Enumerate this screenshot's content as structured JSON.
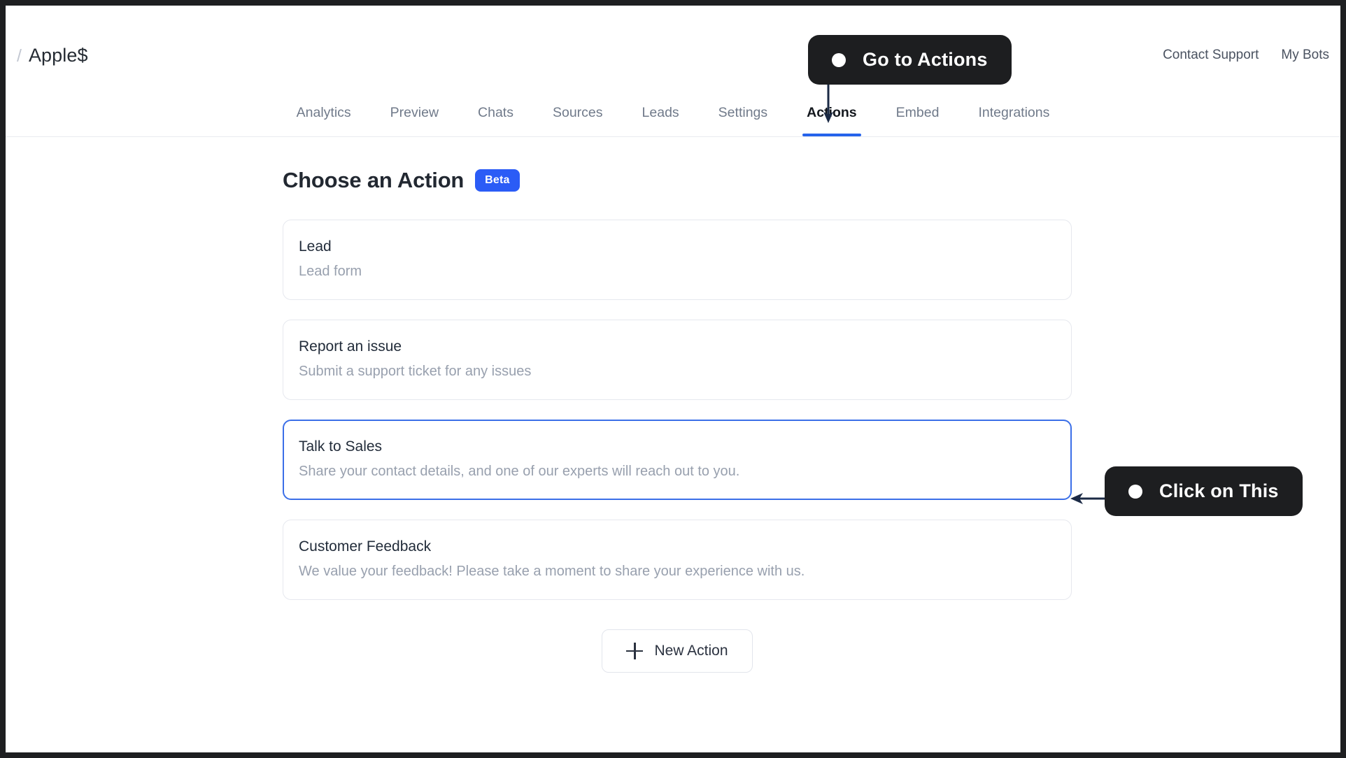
{
  "header": {
    "breadcrumb_separator": "/",
    "breadcrumb_name": "Apple$",
    "links": [
      {
        "label": "Contact Support",
        "name": "contact-support-link"
      },
      {
        "label": "My Bots",
        "name": "my-bots-link"
      }
    ]
  },
  "tabs": [
    {
      "label": "Analytics",
      "active": false
    },
    {
      "label": "Preview",
      "active": false
    },
    {
      "label": "Chats",
      "active": false
    },
    {
      "label": "Sources",
      "active": false
    },
    {
      "label": "Leads",
      "active": false
    },
    {
      "label": "Settings",
      "active": false
    },
    {
      "label": "Actions",
      "active": true
    },
    {
      "label": "Embed",
      "active": false
    },
    {
      "label": "Integrations",
      "active": false
    }
  ],
  "main": {
    "title": "Choose an Action",
    "badge": "Beta",
    "actions": [
      {
        "title": "Lead",
        "description": "Lead form",
        "selected": false
      },
      {
        "title": "Report an issue",
        "description": "Submit a support ticket for any issues",
        "selected": false
      },
      {
        "title": "Talk to Sales",
        "description": "Share your contact details, and one of our experts will reach out to you.",
        "selected": true
      },
      {
        "title": "Customer Feedback",
        "description": "We value your feedback! Please take a moment to share your experience with us.",
        "selected": false
      }
    ],
    "new_action_label": "New Action"
  },
  "callouts": [
    {
      "label": "Go to Actions",
      "target": "actions-tab"
    },
    {
      "label": "Click on This",
      "target": "talk-to-sales-card"
    }
  ],
  "colors": {
    "accent_blue": "#2563eb",
    "badge_blue": "#2b5cf6",
    "selected_border": "#3b6fe8",
    "callout_bg": "#1d1e20",
    "frame": "#1e1f21",
    "muted_text": "#98a0ae"
  }
}
